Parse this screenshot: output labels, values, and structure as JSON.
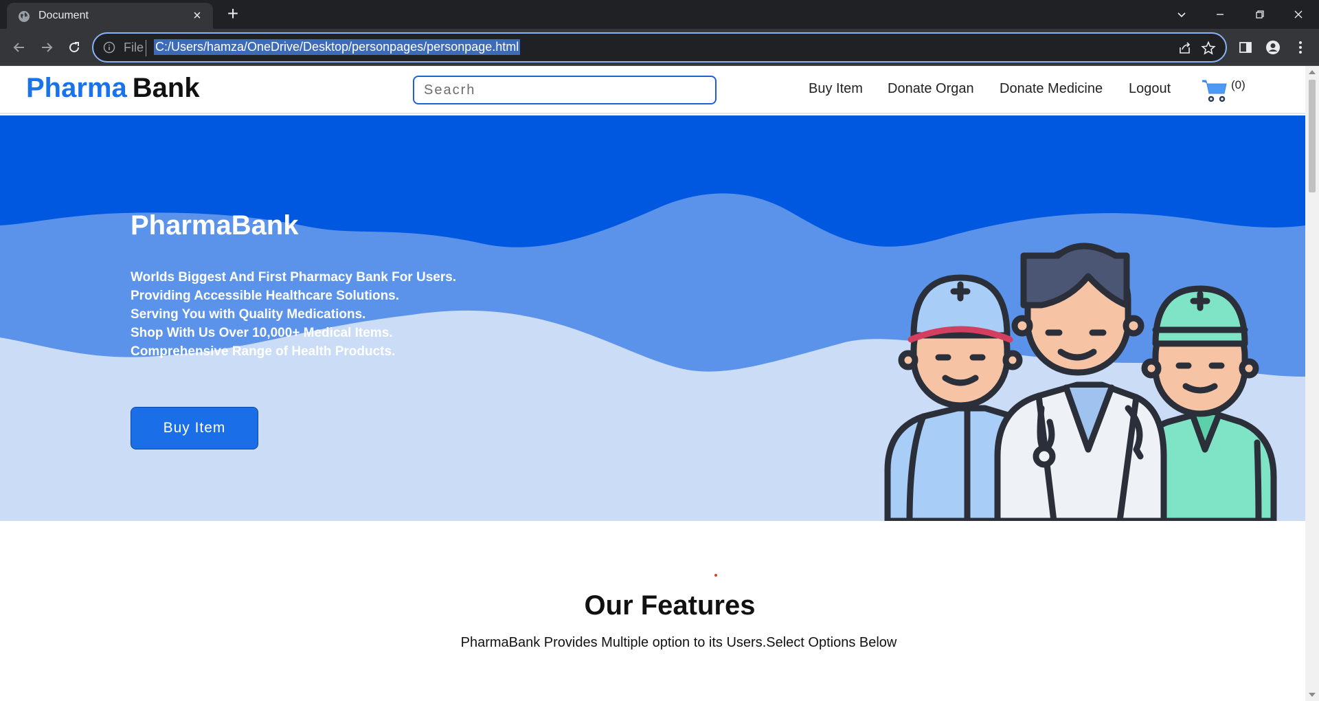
{
  "browser": {
    "tab_title": "Document",
    "omnibox_scheme": "File",
    "url": "C:/Users/hamza/OneDrive/Desktop/personpages/personpage.html"
  },
  "nav": {
    "brand_first": "Pharma",
    "brand_second": "Bank",
    "search_placeholder": "Seacrh",
    "links": [
      "Buy Item",
      "Donate Organ",
      "Donate Medicine",
      "Logout"
    ],
    "cart_count": "(0)"
  },
  "hero": {
    "title": "PharmaBank",
    "lines": [
      "Worlds Biggest And First Pharmacy Bank For Users.",
      "Providing Accessible Healthcare Solutions.",
      "Serving You with Quality Medications.",
      "Shop With Us Over 10,000+ Medical Items.",
      "Comprehensive Range of Health Products."
    ],
    "button": "Buy Item"
  },
  "features": {
    "title": "Our Features",
    "subtitle": "PharmaBank Provides Multiple option to its Users.Select Options Below"
  },
  "colors": {
    "accent": "#1a73e8",
    "hero_dark": "#0058e0",
    "hero_mid": "#5b93ea",
    "hero_light": "#cbdcf7"
  }
}
